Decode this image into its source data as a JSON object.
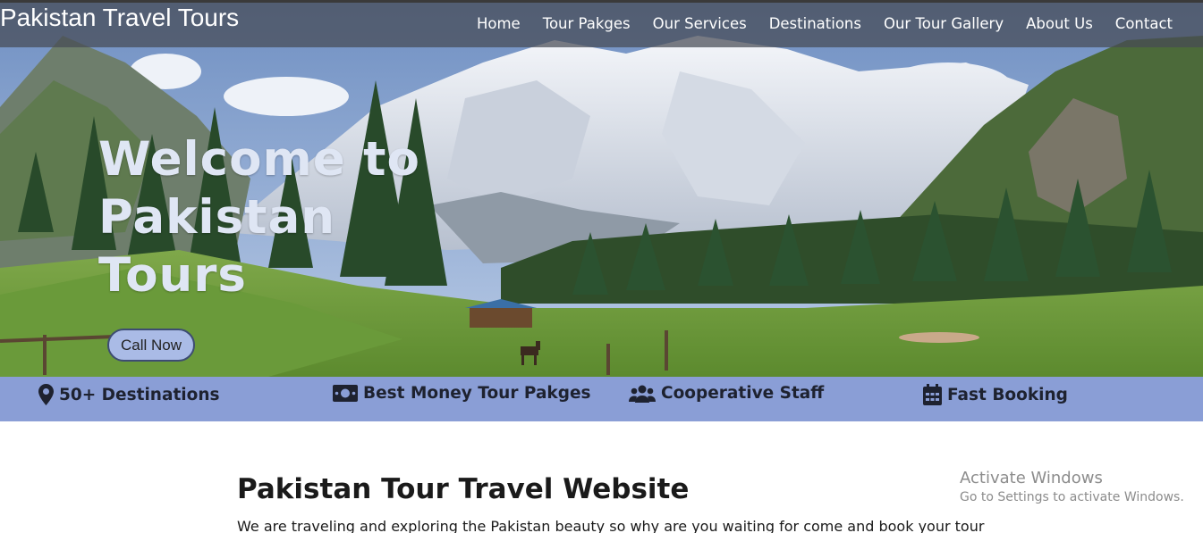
{
  "header": {
    "brand": "Pakistan Travel Tours",
    "nav": [
      "Home",
      "Tour Pakges",
      "Our Services",
      "Destinations",
      "Our Tour Gallery",
      "About Us",
      "Contact"
    ]
  },
  "hero": {
    "title": "Welcome to Pakistan Tours",
    "cta_label": "Call Now"
  },
  "features": [
    {
      "icon": "map-marker-icon",
      "label": "50+ Destinations"
    },
    {
      "icon": "money-icon",
      "label": "Best Money Tour Pakges"
    },
    {
      "icon": "users-icon",
      "label": "Cooperative Staff"
    },
    {
      "icon": "calendar-icon",
      "label": "Fast Booking"
    }
  ],
  "content": {
    "title": "Pakistan Tour Travel Website",
    "text": "We are traveling and exploring the Pakistan beauty so why are you waiting for come and book your tour"
  },
  "watermark": {
    "line1": "Activate Windows",
    "line2": "Go to Settings to activate Windows."
  },
  "colors": {
    "feature_bar": "#8a9ed6",
    "button": "#aabbe6",
    "header_overlay": "#464b55"
  }
}
